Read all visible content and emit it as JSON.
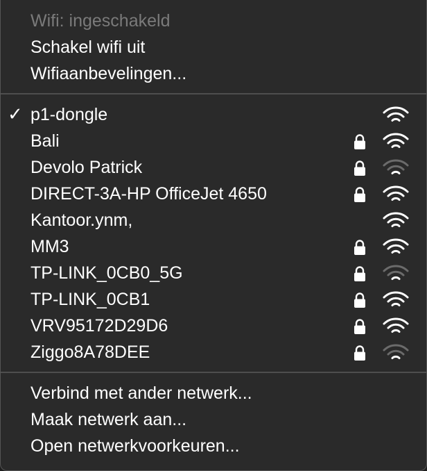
{
  "header": {
    "status": "Wifi: ingeschakeld",
    "toggle": "Schakel wifi uit",
    "recommendations": "Wifiaanbevelingen..."
  },
  "networks": [
    {
      "name": "p1-dongle",
      "connected": true,
      "locked": false,
      "signal_bars": 3
    },
    {
      "name": "Bali",
      "connected": false,
      "locked": true,
      "signal_bars": 3
    },
    {
      "name": "Devolo Patrick",
      "connected": false,
      "locked": true,
      "signal_bars": 1
    },
    {
      "name": "DIRECT-3A-HP OfficeJet 4650",
      "connected": false,
      "locked": true,
      "signal_bars": 3
    },
    {
      "name": "Kantoor.ynm,",
      "connected": false,
      "locked": false,
      "signal_bars": 3
    },
    {
      "name": "MM3",
      "connected": false,
      "locked": true,
      "signal_bars": 3
    },
    {
      "name": "TP-LINK_0CB0_5G",
      "connected": false,
      "locked": true,
      "signal_bars": 1
    },
    {
      "name": "TP-LINK_0CB1",
      "connected": false,
      "locked": true,
      "signal_bars": 3
    },
    {
      "name": "VRV95172D29D6",
      "connected": false,
      "locked": true,
      "signal_bars": 3
    },
    {
      "name": "Ziggo8A78DEE",
      "connected": false,
      "locked": true,
      "signal_bars": 1
    }
  ],
  "footer": {
    "connect_other": "Verbind met ander netwerk...",
    "create_network": "Maak netwerk aan...",
    "open_prefs": "Open netwerkvoorkeuren..."
  },
  "icons": {
    "check": "✓",
    "lock": "lock-icon",
    "wifi": "wifi-signal-icon"
  },
  "colors": {
    "background": "#2a2a2a",
    "text": "#ffffff",
    "disabled_text": "#7a7a7a",
    "separator": "#4e4e4e",
    "dim_signal": "#6b6b6b"
  }
}
